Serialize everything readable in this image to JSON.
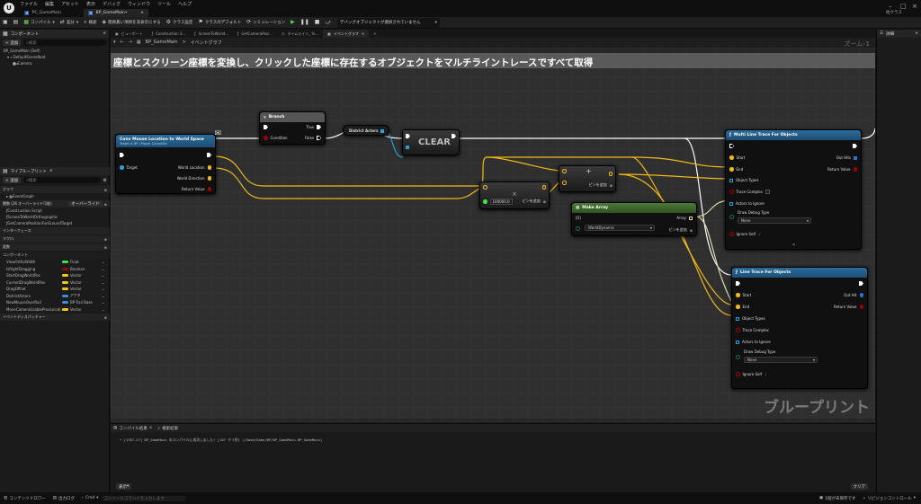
{
  "window": {
    "menu": [
      "ファイル",
      "編集",
      "アセット",
      "表示",
      "デバッグ",
      "ウィンドウ",
      "ツール",
      "ヘルプ"
    ],
    "tabs": [
      "PC_GameMain",
      "BP_GameMain•"
    ],
    "user": "他クラス"
  },
  "toolbar": {
    "compile": "コンパイル",
    "diff": "差分",
    "search": "検索",
    "hide_unrelated": "関係無い項目を非表示にする",
    "class_settings": "クラス設定",
    "class_defaults": "クラスのデフォルト",
    "simulation": "シミュレーション",
    "debug_filter": "デバッグオブジェクトが選択されていません"
  },
  "components": {
    "title": "コンポーネント",
    "add": "+ 追加",
    "search_placeholder": "検索",
    "items": [
      "BP_GameMain (Self)",
      "DefaultSceneRoot",
      "Camera"
    ]
  },
  "mybp": {
    "title": "マイブループリント",
    "add": "+ 追加",
    "search_placeholder": "検索",
    "graphs_label": "グラフ",
    "event_graph": "EventGraph",
    "funcs_label": "関数 (26 オーバーライド可能)",
    "override": "オーバーライド",
    "functions": [
      "Construction Script",
      "ScreenToWorldOrthographic",
      "GetCameraPositionForGroundTarget"
    ],
    "interfaces": "インターフェース",
    "macros": "マクロ",
    "variables": "変数",
    "components_cat": "コンポーネント",
    "vars": [
      {
        "name": "ViewOrthoWidth",
        "type": "Float",
        "color": "#3de53d"
      },
      {
        "name": "IsRightDragging",
        "type": "Boolean",
        "color": "#9b0101"
      },
      {
        "name": "StartDragWorldPos",
        "type": "Vector",
        "color": "#f8c51a"
      },
      {
        "name": "CurrentDragWorldPos",
        "type": "Vector",
        "color": "#f8c51a"
      },
      {
        "name": "DragOffset",
        "type": "Vector",
        "color": "#f8c51a"
      },
      {
        "name": "DistrictActors",
        "type": "アクタ",
        "color": "#3a8dd6"
      },
      {
        "name": "NewMouseOverRail",
        "type": "BP Rail Base",
        "color": "#3a8dd6"
      },
      {
        "name": "MoveCameraUsableProxLocati...",
        "type": "Vector",
        "color": "#f8c51a"
      }
    ],
    "dispatchers": "イベントディスパッチャー"
  },
  "graph_tabs": [
    "ビューポート",
    "Construction S...",
    "ScreenToWorld...",
    "GetCameraPosi...",
    "タイムライン_ %...",
    "イベントグラフ"
  ],
  "breadcrumb": {
    "bp": "BP_GameMain",
    "sep": ">",
    "graph": "イベントグラフ"
  },
  "zoom": "ズーム-1",
  "comment": "座標とスクリーン座標を変換し、クリックした座標に存在するオブジェクトをマルチライントレースですべて取得",
  "nodes": {
    "deproject": {
      "title": "Conv Mouse Location to World Space",
      "subtitle": "Target is BP | Player Controller",
      "target": "Target",
      "world_location": "World Location",
      "world_direction": "World Direction",
      "return_value": "Return Value"
    },
    "branch": {
      "title": "Branch",
      "condition": "Condition",
      "true": "True",
      "false": "False"
    },
    "district": {
      "title": "District Actors"
    },
    "clear": {
      "title": "CLEAR"
    },
    "multiply": {
      "value": "100000.0",
      "add_pin": "ピンを追加"
    },
    "add": {
      "symbol": "+",
      "add_pin": "ピンを追加"
    },
    "makearray": {
      "title": "Make Array",
      "index": "[0]",
      "object": "WorldDynamic",
      "array": "Array",
      "add_pin": "ピンを追加"
    },
    "multi": {
      "title": "Multi Line Trace For Objects",
      "start": "Start",
      "end": "End",
      "out_hits": "Out Hits",
      "return_value": "Return Value",
      "object_types": "Object Types",
      "trace_complex": "Trace Complex",
      "actors_ignore": "Actors to Ignore",
      "draw_debug": "Draw Debug Type",
      "debug_value": "None",
      "ignore_self": "Ignore Self"
    },
    "single": {
      "title": "Line Trace For Objects",
      "start": "Start",
      "end": "End",
      "out_hit": "Out Hit",
      "return_value": "Return Value",
      "object_types": "Object Types",
      "trace_complex": "Trace Complex",
      "actors_ignore": "Actors to Ignore",
      "draw_debug": "Draw Debug Type",
      "debug_value": "None",
      "ignore_self": "Ignore Self"
    }
  },
  "watermark": "ブループリント",
  "log": {
    "tab1": "コンパイル結果",
    "tab2": "検索結果",
    "line": "• [1787.27] BP_GameMain のコンパイルに成功しました! [107 ミリ秒] (/Game/Game/BP/BP_GameMain.BP_GameMain)",
    "filter": "表示",
    "clear": "クリア"
  },
  "details": {
    "title": "詳細"
  },
  "status": {
    "drawer": "コンテンツドロワー",
    "output_log": "出力ログ",
    "cmd": "Cmd",
    "cmd_placeholder": "コンソールコマンドを入力します",
    "unsaved": "1個が未保存です",
    "revision": "リビジョンコントロール"
  }
}
